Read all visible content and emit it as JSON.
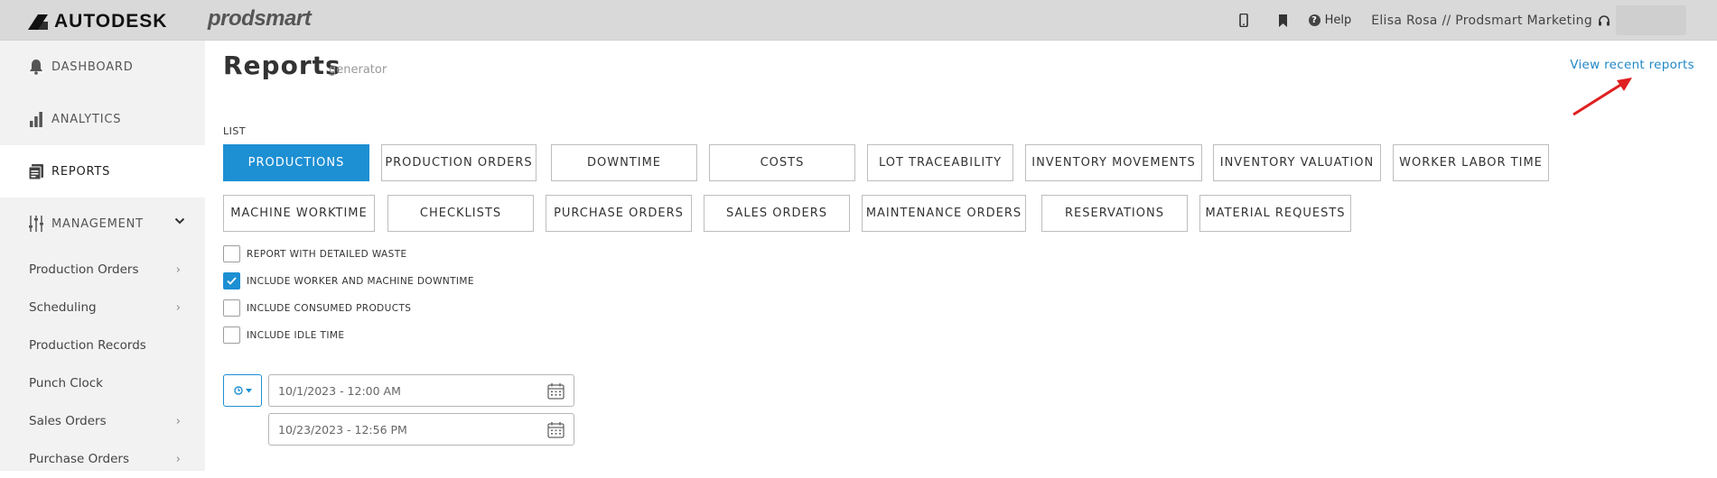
{
  "topbar": {
    "brand": "AUTODESK",
    "product": "prodsmart",
    "help_label": "Help",
    "user_label": "Elisa Rosa // Prodsmart Marketing",
    "icons": [
      "mobile-icon",
      "bookmark-icon",
      "help-icon",
      "headset-icon"
    ]
  },
  "sidebar": {
    "main": [
      {
        "label": "DASHBOARD",
        "icon": "bell-icon"
      },
      {
        "label": "ANALYTICS",
        "icon": "bar-chart-icon"
      },
      {
        "label": "REPORTS",
        "icon": "reports-icon",
        "active": true
      },
      {
        "label": "MANAGEMENT",
        "icon": "sliders-icon",
        "expanded": true
      }
    ],
    "sub": [
      {
        "label": "Production Orders",
        "has_children": true
      },
      {
        "label": "Scheduling",
        "has_children": true
      },
      {
        "label": "Production Records",
        "has_children": false
      },
      {
        "label": "Punch Clock",
        "has_children": false
      },
      {
        "label": "Sales Orders",
        "has_children": true
      },
      {
        "label": "Purchase Orders",
        "has_children": true
      }
    ]
  },
  "page": {
    "title": "Reports",
    "subtitle": "generator",
    "recent_link": "View recent reports",
    "list_label": "LIST"
  },
  "report_types": {
    "row1": [
      "PRODUCTIONS",
      "PRODUCTION ORDERS",
      "DOWNTIME",
      "COSTS",
      "LOT TRACEABILITY",
      "INVENTORY MOVEMENTS",
      "INVENTORY VALUATION",
      "WORKER LABOR TIME"
    ],
    "row2": [
      "MACHINE WORKTIME",
      "CHECKLISTS",
      "PURCHASE ORDERS",
      "SALES ORDERS",
      "MAINTENANCE ORDERS",
      "RESERVATIONS",
      "MATERIAL REQUESTS"
    ],
    "selected": "PRODUCTIONS"
  },
  "options": [
    {
      "label": "REPORT WITH DETAILED WASTE",
      "checked": false
    },
    {
      "label": "INCLUDE WORKER AND MACHINE DOWNTIME",
      "checked": true
    },
    {
      "label": "INCLUDE CONSUMED PRODUCTS",
      "checked": false
    },
    {
      "label": "INCLUDE IDLE TIME",
      "checked": false
    }
  ],
  "date_range": {
    "start": "10/1/2023 - 12:00 AM",
    "end": "10/23/2023 - 12:56 PM"
  },
  "colors": {
    "accent": "#1d8fd3",
    "link": "#1f87c6",
    "annotation_arrow": "#e01f1f"
  }
}
